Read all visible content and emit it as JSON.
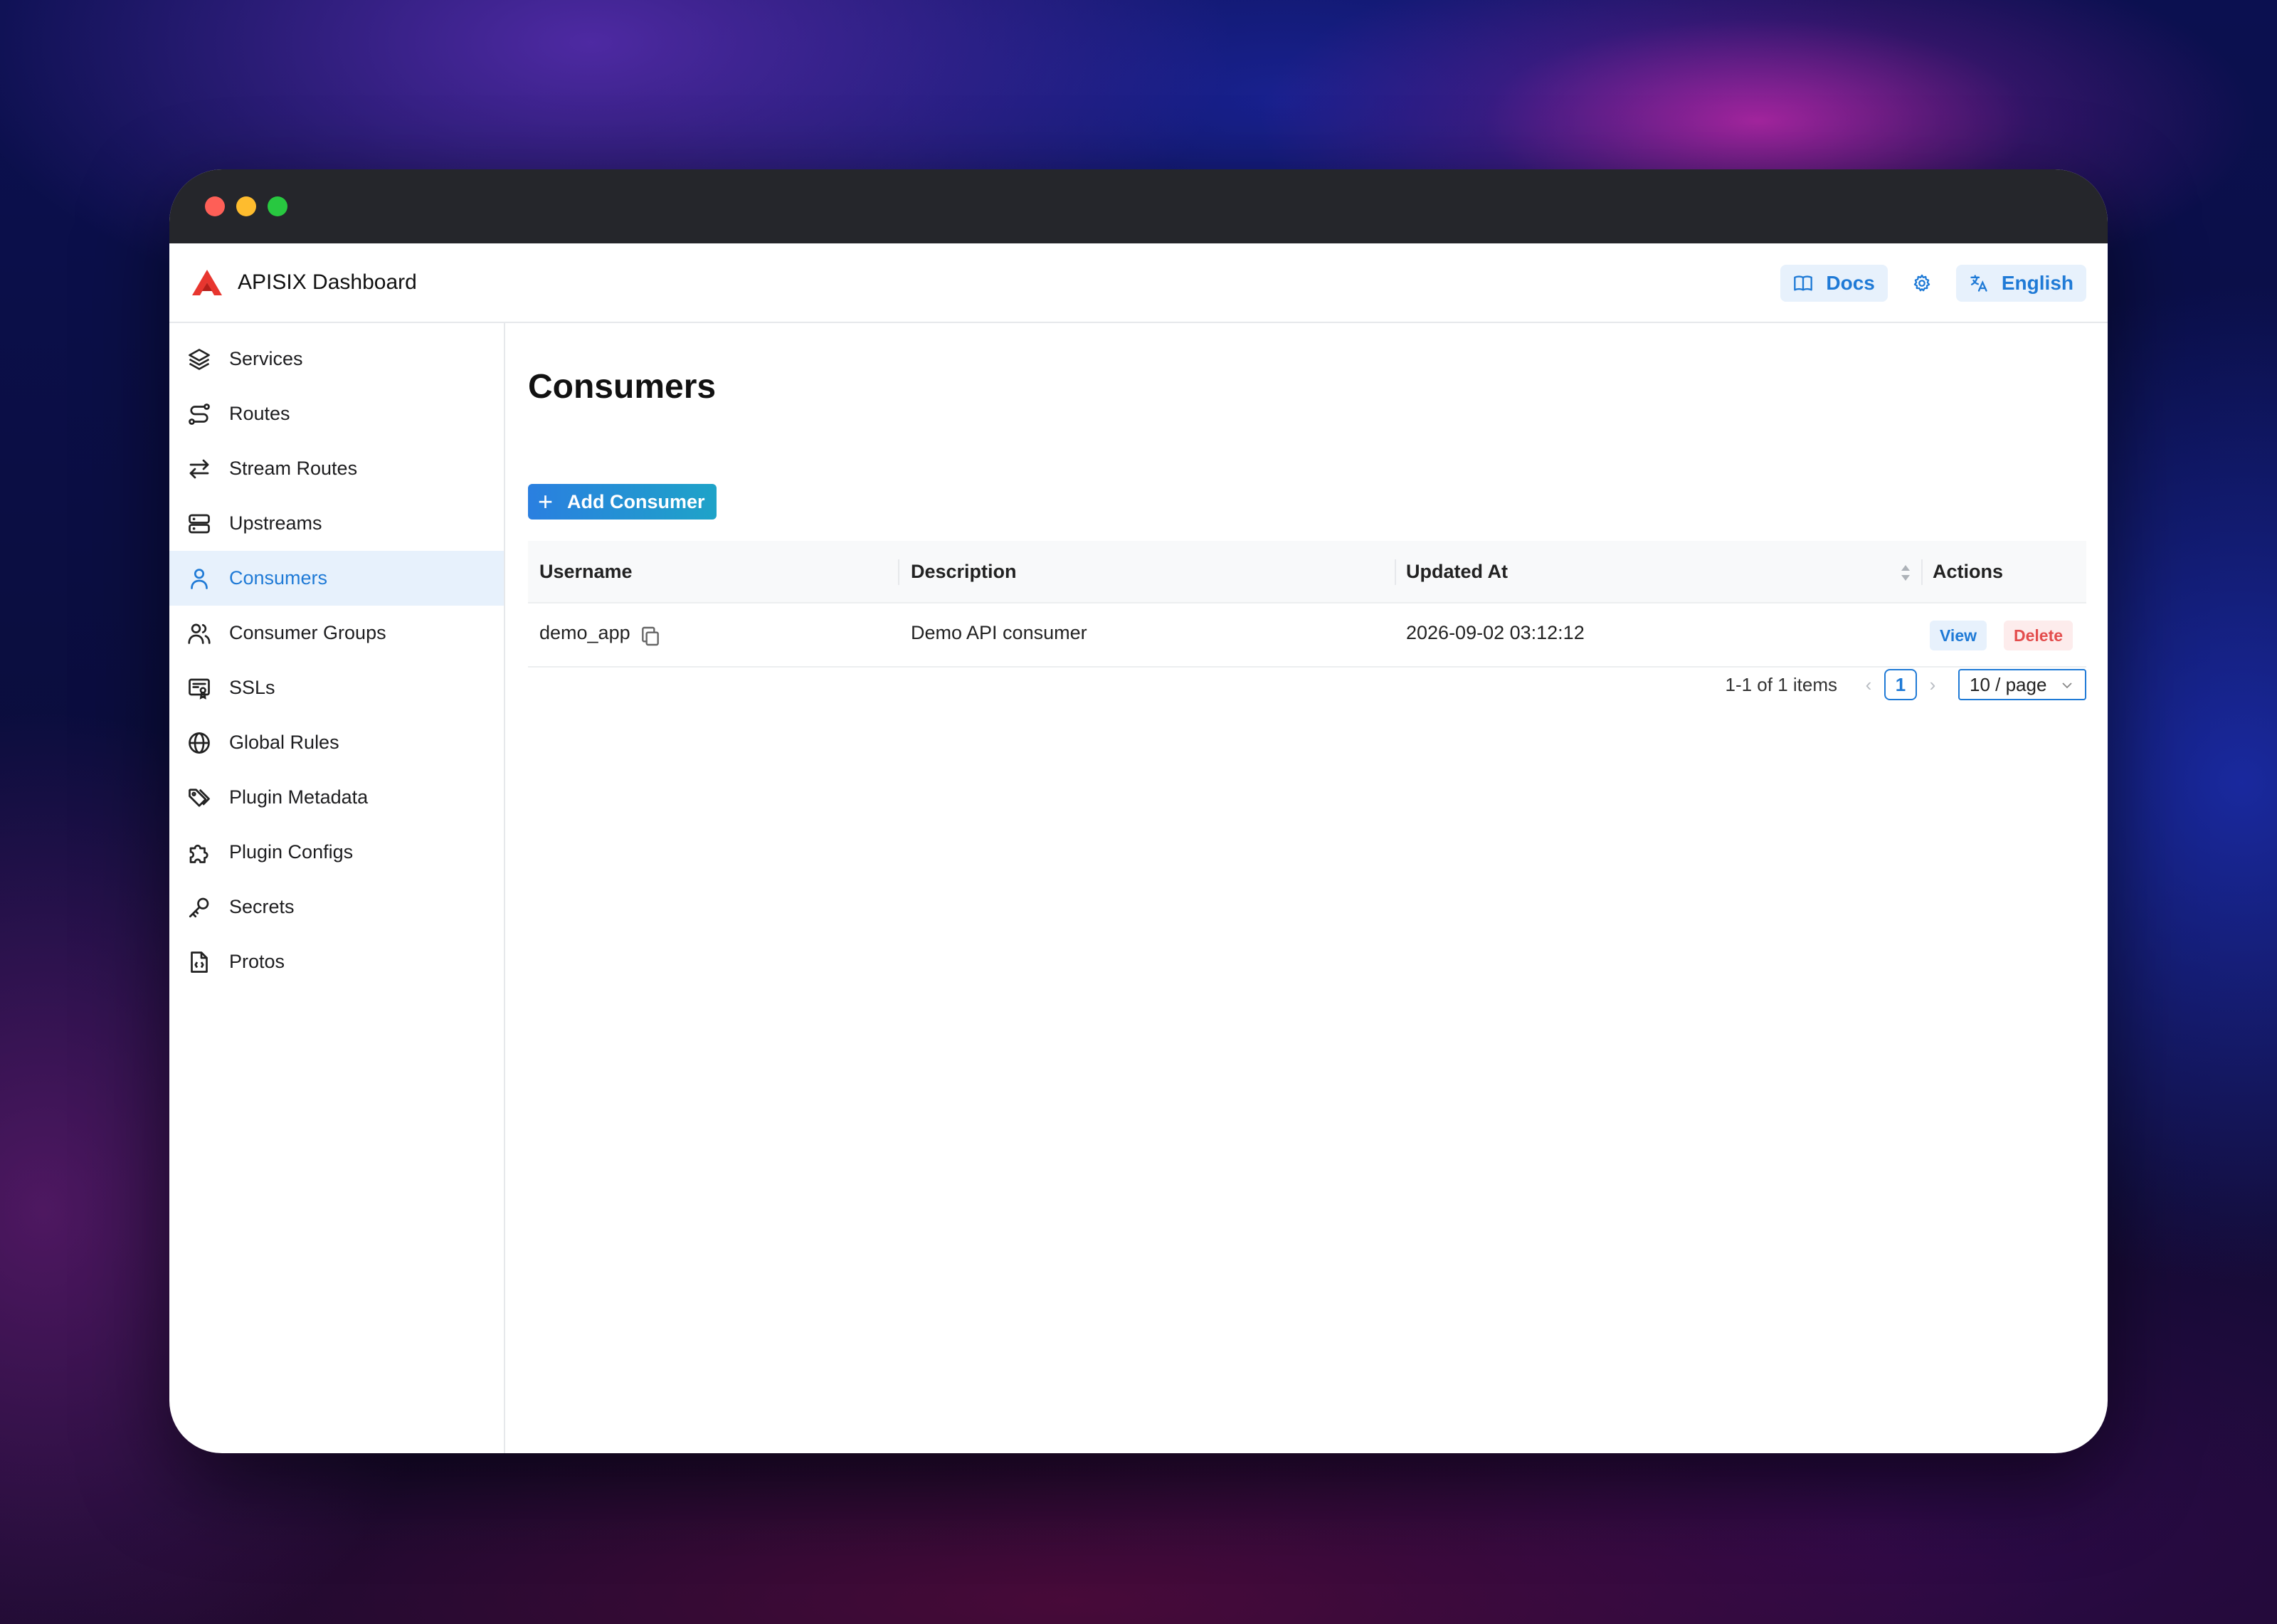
{
  "app": {
    "title": "APISIX Dashboard",
    "brand_color": "#e8362f",
    "accent_color": "#1f7ad6"
  },
  "header": {
    "docs_label": "Docs",
    "docs_icon": "book-icon",
    "settings_icon": "gear-icon",
    "language_label": "English",
    "language_icon": "translate-icon"
  },
  "sidebar": {
    "items": [
      {
        "label": "Services",
        "icon": "stack-icon",
        "active": false
      },
      {
        "label": "Routes",
        "icon": "route-icon",
        "active": false
      },
      {
        "label": "Stream Routes",
        "icon": "arrows-exchange-icon",
        "active": false
      },
      {
        "label": "Upstreams",
        "icon": "server-icon",
        "active": false
      },
      {
        "label": "Consumers",
        "icon": "user-icon",
        "active": true
      },
      {
        "label": "Consumer Groups",
        "icon": "users-icon",
        "active": false
      },
      {
        "label": "SSLs",
        "icon": "certificate-icon",
        "active": false
      },
      {
        "label": "Global Rules",
        "icon": "globe-icon",
        "active": false
      },
      {
        "label": "Plugin Metadata",
        "icon": "tags-icon",
        "active": false
      },
      {
        "label": "Plugin Configs",
        "icon": "puzzle-icon",
        "active": false
      },
      {
        "label": "Secrets",
        "icon": "key-icon",
        "active": false
      },
      {
        "label": "Protos",
        "icon": "file-code-icon",
        "active": false
      }
    ]
  },
  "main": {
    "title": "Consumers",
    "add_button_label": "Add Consumer",
    "table": {
      "columns": [
        "Username",
        "Description",
        "Updated At",
        "Actions"
      ],
      "rows": [
        {
          "username": "demo_app",
          "description": "Demo API consumer",
          "updated_at": "2026-09-02 03:12:12",
          "actions": [
            "View",
            "Delete"
          ]
        }
      ]
    },
    "pagination": {
      "summary": "1-1 of 1 items",
      "current_page": "1",
      "page_size": "10 / page"
    }
  }
}
